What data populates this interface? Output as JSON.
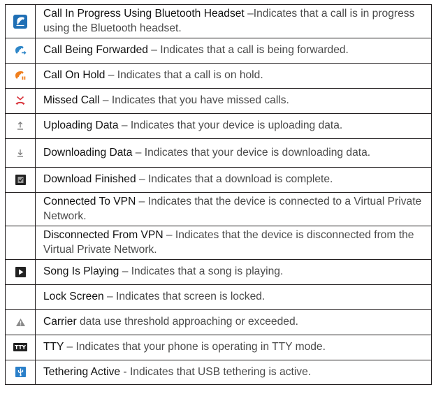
{
  "rows": [
    {
      "icon": "call-bluetooth-icon",
      "term": "Call In Progress Using Bluetooth Headset",
      "desc": " –Indicates that a call is in progress using the Bluetooth headset."
    },
    {
      "icon": "call-forwarded-icon",
      "term": "Call Being Forwarded",
      "desc": " – Indicates that a call is being forwarded."
    },
    {
      "icon": "call-on-hold-icon",
      "term": "Call On Hold",
      "desc": " – Indicates that a call is on hold."
    },
    {
      "icon": "missed-call-icon",
      "term": "Missed Call",
      "desc": " – Indicates that you have missed calls."
    },
    {
      "icon": "uploading-data-icon",
      "term": "Uploading Data",
      "desc": " – Indicates that your device is uploading data."
    },
    {
      "icon": "downloading-data-icon",
      "term": "Downloading Data",
      "desc": " – Indicates that your device is downloading data."
    },
    {
      "icon": "download-finished-icon",
      "term": "Download Finished",
      "desc": " – Indicates that a download is complete."
    },
    {
      "icon": "",
      "term": "Connected To VPN",
      "desc": " – Indicates that the device is connected to a Virtual Private Network."
    },
    {
      "icon": "",
      "term": "Disconnected From VPN",
      "desc": " – Indicates that the device is disconnected from the Virtual Private Network."
    },
    {
      "icon": "song-playing-icon",
      "term": "Song Is Playing",
      "desc": " – Indicates that a song is playing."
    },
    {
      "icon": "",
      "term": "Lock Screen",
      "desc": " – Indicates that screen is locked."
    },
    {
      "icon": "carrier-warning-icon",
      "term": "Carrier",
      "desc": " data use threshold approaching or exceeded."
    },
    {
      "icon": "tty-icon",
      "term": "TTY",
      "desc": " – Indicates that your phone is operating in TTY mode."
    },
    {
      "icon": "usb-tethering-icon",
      "term": "Tethering Active",
      "desc": " - Indicates that USB tethering is active."
    }
  ],
  "icon_labels": {
    "tty": "TTY"
  },
  "colors": {
    "bluetooth_call_bg": "#1f6fb5",
    "forward_call": "#2e86c8",
    "hold_call": "#f07f1e",
    "missed_call": "#d8343c",
    "arrow_gray": "#7a7a7a",
    "dark_icon": "#222222",
    "tethering_blue": "#2a7fc9"
  }
}
